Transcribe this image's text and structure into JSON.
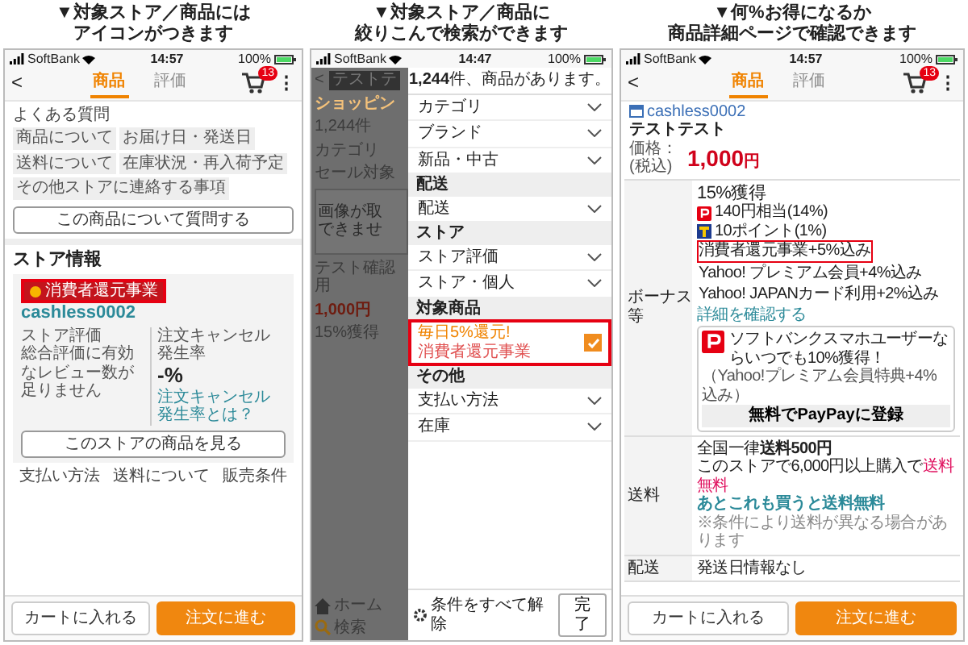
{
  "store_page": {
    "caption": [
      "▼対象ストア／商品には",
      "アイコンがつきます"
    ],
    "status_bar": {
      "carrier": "SoftBank",
      "time": "14:57",
      "battery": "100%"
    },
    "nav": {
      "back": "<",
      "tabs": [
        {
          "label": "商品",
          "selected": true
        },
        {
          "label": "評価",
          "selected": false
        }
      ],
      "cart_count": "13",
      "menu": "⋮"
    },
    "faq": {
      "title": "よくある質問",
      "tags": [
        "商品について",
        "お届け日・発送日",
        "送料について",
        "在庫状況・再入荷予定",
        "その他ストアに連絡する事項"
      ],
      "button": "この商品について質問する"
    },
    "store": {
      "title": "ストア情報",
      "badge": {
        "label": "消費者還元事業",
        "highlighted": true
      },
      "name": "cashless0002",
      "rating_label": "ストア評価",
      "rating_note": "総合評価に有効なレビュー数が足りません",
      "cancel_label": "注文キャンセル発生率",
      "cancel_value": "-%",
      "cancel_link": "注文キャンセル発生率とは？",
      "button": "このストアの商品を見る"
    },
    "links": [
      "支払い方法",
      "送料について",
      "販売条件"
    ],
    "actions": {
      "cart": "カートに入れる",
      "order": "注文に進む"
    }
  },
  "filter_page": {
    "caption": [
      "▼対象ストア／商品に",
      "絞りこんで検索ができます"
    ],
    "status_bar": {
      "carrier": "SoftBank",
      "time": "14:47",
      "battery": "100%"
    },
    "background": {
      "back": "<",
      "search_chip": "テストテ",
      "tab": "ショッピン",
      "tab_count": "1,244件",
      "category": "カテゴリ",
      "sale_filter": "セール対象",
      "image_note": [
        "画像が取",
        "できませ"
      ],
      "product_name": "テスト確認用",
      "product_price": "1,000円",
      "product_points": "15%獲得",
      "nav": [
        "ホーム",
        "検索"
      ]
    },
    "panel": {
      "count": "**1,244**件、商品があります。",
      "rows": [
        {
          "kind": "dropdown",
          "label": "カテゴリ"
        },
        {
          "kind": "dropdown",
          "label": "ブランド"
        },
        {
          "kind": "dropdown",
          "label": "新品・中古"
        },
        {
          "kind": "header",
          "label": "配送"
        },
        {
          "kind": "dropdown",
          "label": "配送"
        },
        {
          "kind": "header",
          "label": "ストア"
        },
        {
          "kind": "dropdown",
          "label": "ストア評価"
        },
        {
          "kind": "dropdown",
          "label": "ストア・個人"
        },
        {
          "kind": "header",
          "label": "対象商品"
        },
        {
          "kind": "checkbox",
          "label": "毎日5%還元!",
          "tag": "消費者還元事業",
          "checked": true,
          "highlighted": true
        },
        {
          "kind": "header",
          "label": "その他"
        },
        {
          "kind": "dropdown",
          "label": "支払い方法"
        },
        {
          "kind": "dropdown",
          "label": "在庫"
        }
      ],
      "clear": "条件をすべて解除",
      "done": "完了"
    }
  },
  "detail_page": {
    "caption": [
      "▼何%お得になるか",
      "商品詳細ページで確認できます"
    ],
    "status_bar": {
      "carrier": "SoftBank",
      "time": "14:57",
      "battery": "100%"
    },
    "nav": {
      "back": "<",
      "tabs": [
        {
          "label": "商品",
          "selected": true
        },
        {
          "label": "評価",
          "selected": false
        }
      ],
      "cart_count": "13",
      "menu": "⋮"
    },
    "store_name": "cashless0002",
    "product_name": "テストテスト",
    "price_label": [
      "価格：",
      "(税込)"
    ],
    "price": "1,000",
    "price_unit": "円",
    "bonus": {
      "label": "ボーナス等",
      "total": "15%獲得",
      "items": [
        {
          "kind": "paypay",
          "text": "140円相当(14%)"
        },
        {
          "kind": "tpoint",
          "text": "10ポイント(1%)"
        }
      ],
      "details": [
        {
          "text": "消費者還元事業+5%込み",
          "highlighted": true
        },
        {
          "text": "Yahoo! プレミアム会員+4%込み",
          "highlighted": false
        },
        {
          "text": "Yahoo! JAPANカード利用+2%込み",
          "highlighted": false
        }
      ],
      "link": "詳細を確認する",
      "promo": {
        "text": "ソフトバンクスマホユーザーならいつでも10%獲得！",
        "note": "（Yahoo!プレミアム会員特典+4%込み）",
        "button": "無料でPayPayに登録"
      }
    },
    "shipping": {
      "label": "送料",
      "title": "全国一律**送料500円**",
      "note": "このストアで6,000円以上購入で",
      "note_highlight": "送料無料",
      "link": "あとこれも買うと送料無料",
      "caveat": "※条件により送料が異なる場合があります"
    },
    "delivery": {
      "label": "配送",
      "text": "発送日情報なし"
    },
    "actions": {
      "cart": "カートに入れる",
      "order": "注文に進む"
    }
  }
}
